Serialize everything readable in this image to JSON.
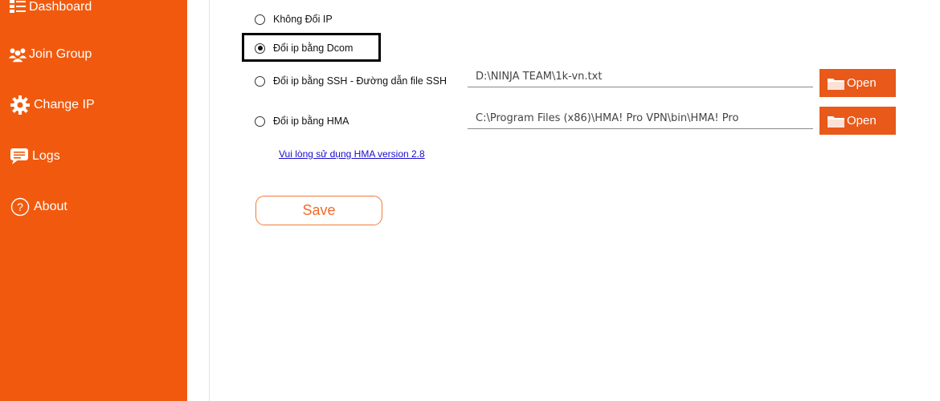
{
  "sidebar": {
    "items": [
      {
        "label": "Dashboard",
        "icon": "dashboard-icon"
      },
      {
        "label": "Join Group",
        "icon": "group-icon"
      },
      {
        "label": "Change IP",
        "icon": "gear-icon"
      },
      {
        "label": "Logs",
        "icon": "chat-icon"
      },
      {
        "label": "About",
        "icon": "question-icon"
      }
    ]
  },
  "options": {
    "no_change": "Không Đổi IP",
    "dcom": "Đổi ip bằng Dcom",
    "ssh": "Đổi ip bằng SSH - Đường dẫn file SSH",
    "hma": "Đổi ip bằng HMA",
    "selected": "dcom"
  },
  "ssh_path": {
    "value": "D:\\NINJA TEAM\\1k-vn.txt"
  },
  "hma_path": {
    "value": "C:\\Program Files (x86)\\HMA! Pro VPN\\bin\\HMA! Pro"
  },
  "buttons": {
    "open_label": "Open",
    "save_label": "Save"
  },
  "hint": "Vui lòng sử dụng HMA version 2.8",
  "colors": {
    "sidebar": "#f15a0e",
    "button": "#e8591a",
    "save_border": "#f07a3d",
    "link": "#1a0dcc"
  }
}
